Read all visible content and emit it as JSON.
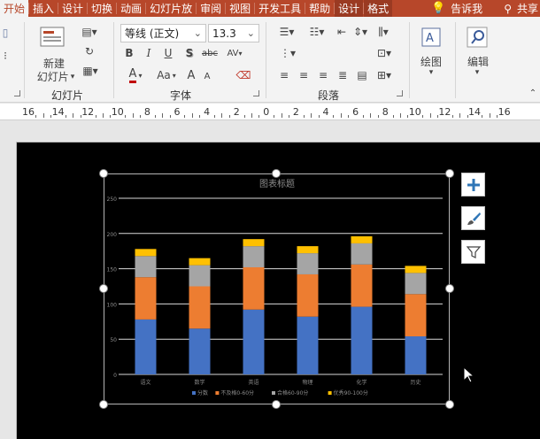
{
  "tabs": [
    {
      "label": "开始",
      "active": true
    },
    {
      "label": "插入"
    },
    {
      "label": "设计"
    },
    {
      "label": "切换"
    },
    {
      "label": "动画"
    },
    {
      "label": "幻灯片放"
    },
    {
      "label": "审阅"
    },
    {
      "label": "视图"
    },
    {
      "label": "开发工具"
    },
    {
      "label": "帮助"
    },
    {
      "label": "设计",
      "contextual": true
    },
    {
      "label": "格式",
      "contextual": true
    }
  ],
  "tellme": "告诉我",
  "share": "共享",
  "ribbon": {
    "slides": {
      "new_slide_line1": "新建",
      "new_slide_line2": "幻灯片",
      "group": "幻灯片"
    },
    "font": {
      "name": "等线 (正文)",
      "size": "13.3",
      "group": "字体",
      "bold": "B",
      "italic": "I",
      "underline": "U",
      "shadow": "S",
      "strike": "abc",
      "spacing": "AV",
      "font_color": "A",
      "change_case": "Aa"
    },
    "paragraph": {
      "group": "段落"
    },
    "drawing": {
      "label": "绘图"
    },
    "editing": {
      "label": "编辑"
    }
  },
  "ruler": {
    "labels": [
      "16",
      "14",
      "12",
      "10",
      "8",
      "6",
      "4",
      "2",
      "0",
      "2",
      "4",
      "6",
      "8",
      "10",
      "12",
      "14",
      "16"
    ]
  },
  "chart_data": {
    "type": "bar",
    "stacked": true,
    "title": "图表标题",
    "categories": [
      "语文",
      "数学",
      "英语",
      "物理",
      "化学",
      "历史"
    ],
    "series": [
      {
        "name": "分数",
        "values": [
          78,
          65,
          92,
          82,
          96,
          54
        ],
        "color": "#4472c4"
      },
      {
        "name": "不及格0-60分",
        "values": [
          60,
          60,
          60,
          60,
          60,
          60
        ],
        "color": "#ed7d31"
      },
      {
        "name": "合格60-90分",
        "values": [
          30,
          30,
          30,
          30,
          30,
          30
        ],
        "color": "#a5a5a5"
      },
      {
        "name": "优秀90-100分",
        "values": [
          10,
          10,
          10,
          10,
          10,
          10
        ],
        "color": "#ffc000"
      }
    ],
    "ylim": [
      0,
      250
    ],
    "yticks": [
      0,
      50,
      100,
      150,
      200,
      250
    ],
    "grid": true,
    "legend": "bottom"
  },
  "chart_tools": [
    {
      "name": "add-element-icon",
      "glyph": "+"
    },
    {
      "name": "style-brush-icon",
      "glyph": "✎"
    },
    {
      "name": "filter-icon",
      "glyph": "▼"
    }
  ]
}
